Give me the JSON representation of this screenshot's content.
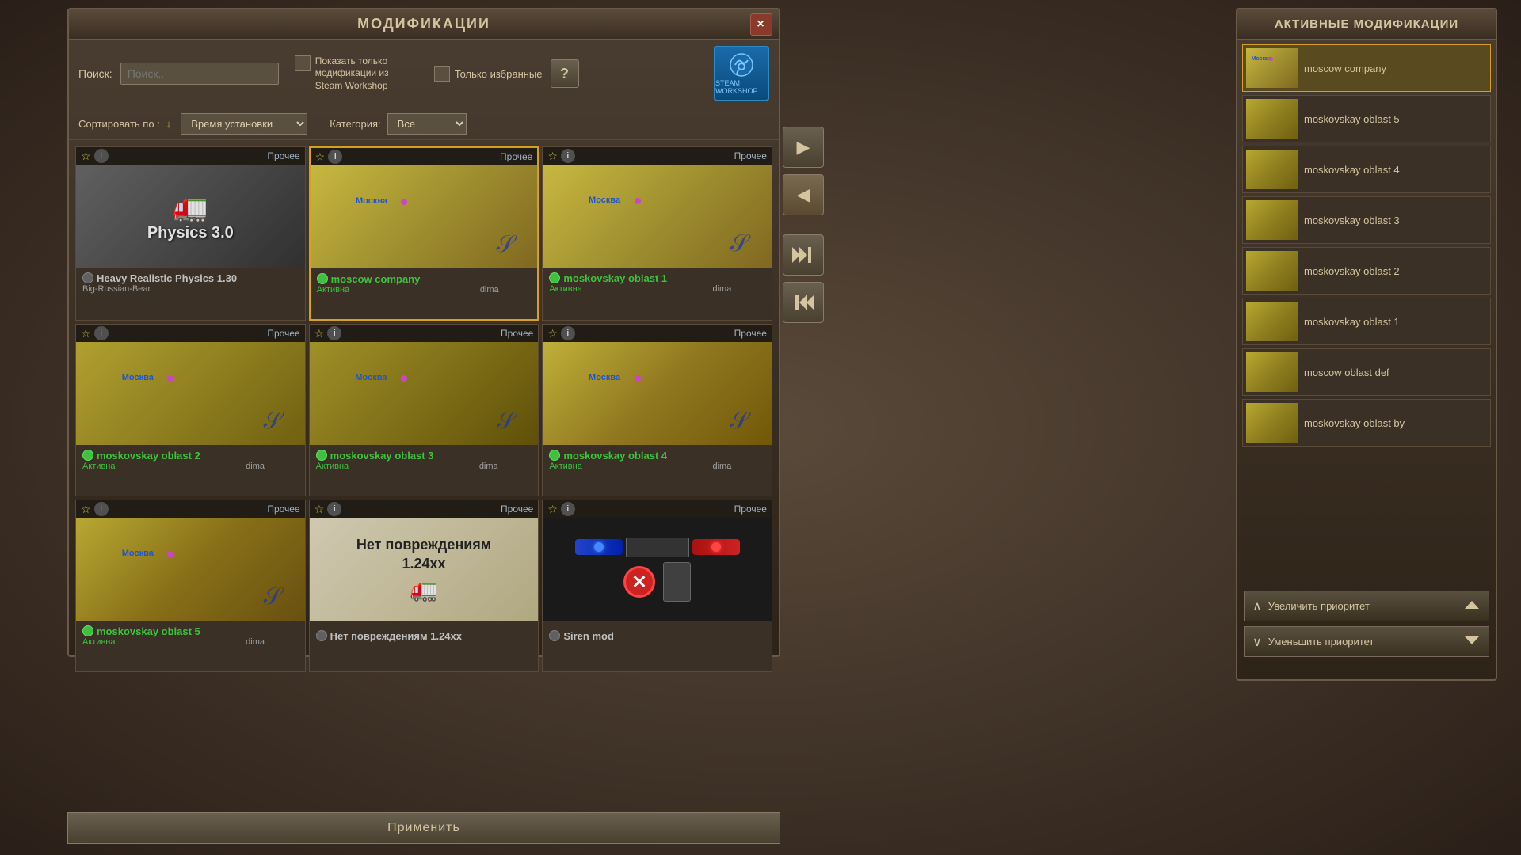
{
  "modal": {
    "title": "МОДИФИКАЦИИ",
    "close_label": "×",
    "search_label": "Поиск:",
    "search_placeholder": "Поиск..",
    "steam_only_label": "Показать только модификации из Steam Workshop",
    "favorites_label": "Только избранные",
    "sort_label": "Сортировать по :",
    "sort_value": "Время установки",
    "category_label": "Категория:",
    "category_value": "Все",
    "apply_label": "Применить"
  },
  "mods": [
    {
      "id": "heavy-physics",
      "name": "Heavy Realistic Physics 1.30",
      "author": "Big-Russian-Bear",
      "status": "inactive",
      "category": "Прочее",
      "thumb_type": "truck"
    },
    {
      "id": "moscow-company",
      "name": "moscow company",
      "author": "dima",
      "status": "active",
      "status_text": "Активна",
      "category": "Прочее",
      "thumb_type": "map",
      "selected": true
    },
    {
      "id": "moskovskay-oblast-1",
      "name": "moskovskay oblast 1",
      "author": "dima",
      "status": "active",
      "status_text": "Активна",
      "category": "Прочее",
      "thumb_type": "map"
    },
    {
      "id": "moskovskay-oblast-2",
      "name": "moskovskay oblast 2",
      "author": "dima",
      "status": "active",
      "status_text": "Активна",
      "category": "Прочее",
      "thumb_type": "map"
    },
    {
      "id": "moskovskay-oblast-3",
      "name": "moskovskay oblast 3",
      "author": "dima",
      "status": "active",
      "status_text": "Активна",
      "category": "Прочее",
      "thumb_type": "map"
    },
    {
      "id": "moskovskay-oblast-4",
      "name": "moskovskay oblast 4",
      "author": "dima",
      "status": "active",
      "status_text": "Активна",
      "category": "Прочее",
      "thumb_type": "map"
    },
    {
      "id": "moskovskay-oblast-5",
      "name": "moskovskay oblast 5",
      "author": "dima",
      "status": "active",
      "status_text": "Активна",
      "category": "Прочее",
      "thumb_type": "map"
    },
    {
      "id": "no-damage",
      "name": "Нет повреждениям 1.24хх",
      "author": "",
      "status": "inactive",
      "category": "Прочее",
      "thumb_type": "nodamage"
    },
    {
      "id": "siren",
      "name": "Siren mod",
      "author": "",
      "status": "inactive",
      "category": "Прочее",
      "thumb_type": "siren"
    }
  ],
  "active_mods_title": "АКТИВНЫЕ МОДИФИКАЦИИ",
  "active_mods": [
    {
      "id": "moscow-company",
      "name": "moscow company",
      "selected": true
    },
    {
      "id": "moskovskay-oblast-5",
      "name": "moskovskay oblast 5"
    },
    {
      "id": "moskovskay-oblast-4",
      "name": "moskovskay oblast 4"
    },
    {
      "id": "moskovskay-oblast-3",
      "name": "moskovskay oblast 3"
    },
    {
      "id": "moskovskay-oblast-2",
      "name": "moskovskay oblast 2"
    },
    {
      "id": "moskovskay-oblast-1",
      "name": "moskovskay oblast 1"
    },
    {
      "id": "moscow-oblast-def",
      "name": "moscow oblast def"
    },
    {
      "id": "moskovskay-oblast-by",
      "name": "moskovskay oblast by"
    }
  ],
  "arrows": {
    "right_label": "▶",
    "left_label": "◀",
    "skip_right_label": "⏭",
    "skip_left_label": "⏮"
  },
  "priority": {
    "increase_label": "Увеличить приоритет",
    "decrease_label": "Уменьшить приоритет"
  },
  "icons": {
    "star": "★",
    "info": "i",
    "help": "?",
    "up_arrow": "∧",
    "down_arrow": "∨",
    "up_chevron": "⌃",
    "down_chevron": "⌄"
  }
}
